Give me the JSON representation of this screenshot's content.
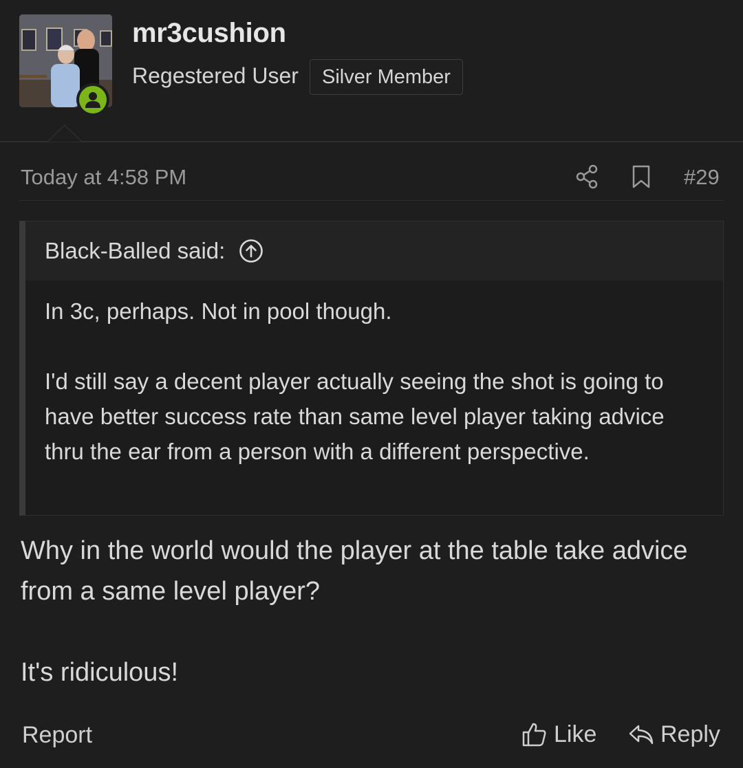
{
  "post": {
    "username": "mr3cushion",
    "user_title": "Regestered User",
    "member_badge": "Silver Member",
    "date": "Today at 4:58 PM",
    "post_number": "#29",
    "online_color": "#7cb518"
  },
  "quote": {
    "author_label": "Black-Balled said:",
    "paragraphs": [
      "In 3c, perhaps. Not in pool though.",
      "I'd still say a decent player actually seeing the shot is going to have better success rate than same level player taking advice thru the ear from a person with a different perspective."
    ]
  },
  "body": {
    "paragraphs": [
      "Why in the world would the player at the table take advice from a same level player?",
      "It's ridiculous!"
    ]
  },
  "actions": {
    "report": "Report",
    "like": "Like",
    "reply": "Reply"
  },
  "icons": {
    "share": "share-icon",
    "bookmark": "bookmark-icon",
    "expand": "arrow-up-circle-icon",
    "like": "thumbs-up-icon",
    "reply": "reply-icon",
    "online": "user-icon"
  }
}
